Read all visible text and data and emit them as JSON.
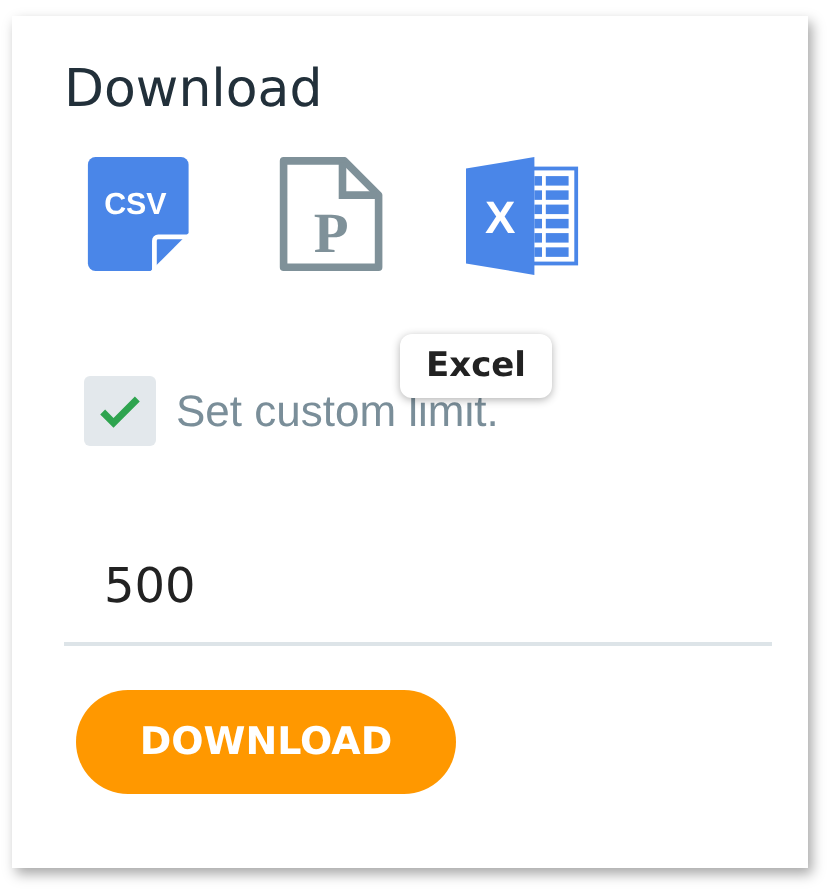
{
  "card": {
    "title": "Download",
    "formats": [
      {
        "kind": "csv",
        "glyph": "CSV"
      },
      {
        "kind": "pdf",
        "glyph": "P"
      },
      {
        "kind": "excel",
        "glyph": "X"
      }
    ],
    "tooltip": {
      "text": "Excel"
    },
    "custom_limit": {
      "label": "Set custom limit.",
      "checked": true
    },
    "limit_field": {
      "value": "500"
    },
    "button": {
      "label": "DOWNLOAD"
    }
  }
}
